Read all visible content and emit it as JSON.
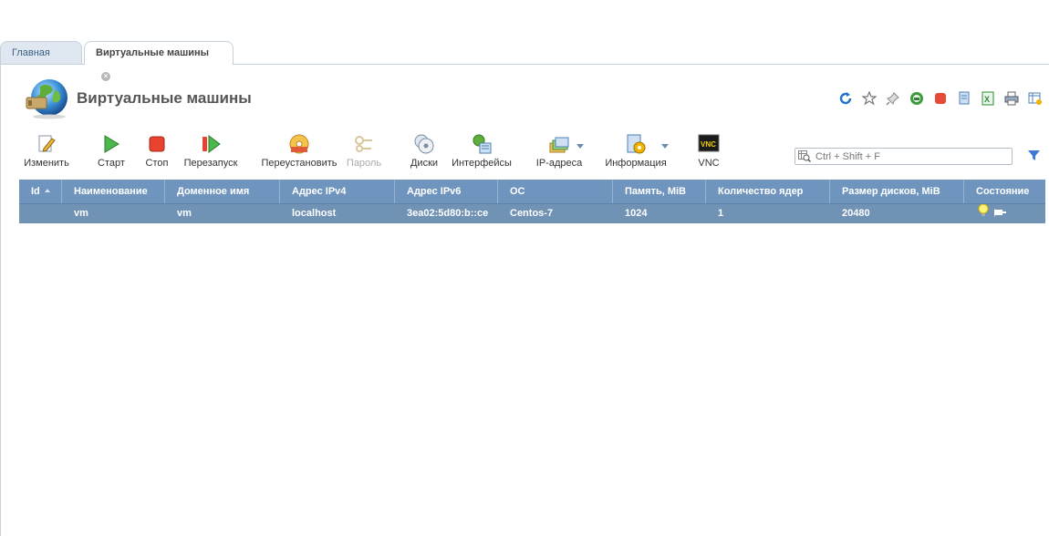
{
  "tabs": [
    {
      "label": "Главная"
    },
    {
      "label": "Виртуальные машины"
    }
  ],
  "page": {
    "title": "Виртуальные машины",
    "icon": "globe-plug-icon"
  },
  "top_icons": [
    "refresh-icon",
    "star-icon",
    "pin-icon",
    "globe-info-icon",
    "stop-square-icon",
    "copy-doc-icon",
    "excel-icon",
    "print-icon",
    "table-settings-icon"
  ],
  "toolbar": {
    "edit": "Изменить",
    "start": "Старт",
    "stop": "Стоп",
    "restart": "Перезапуск",
    "reinstall": "Переустановить",
    "password": "Пароль",
    "disks": "Диски",
    "interfaces": "Интерфейсы",
    "ip": "IP-адреса",
    "info": "Информация",
    "vnc": "VNC"
  },
  "search": {
    "placeholder": "Ctrl + Shift + F"
  },
  "columns": [
    "Id",
    "Наименование",
    "Доменное имя",
    "Адрес IPv4",
    "Адрес IPv6",
    "ОС",
    "Память, MiB",
    "Количество ядер",
    "Размер дисков, MiB",
    "Состояние"
  ],
  "rows": [
    {
      "id": "",
      "name": "vm",
      "domain": "vm",
      "ipv4": "localhost",
      "ipv6": "3ea02:5d80:b::ce",
      "os": "Centos-7",
      "memory": "1024",
      "cores": "1",
      "disk": "20480",
      "state_icons": [
        "bulb-on-icon",
        "flag-icon"
      ]
    }
  ],
  "colors": {
    "header": "#6f95be",
    "selected_row": "#6f92b5",
    "tab_inactive": "#dfe8f1"
  }
}
